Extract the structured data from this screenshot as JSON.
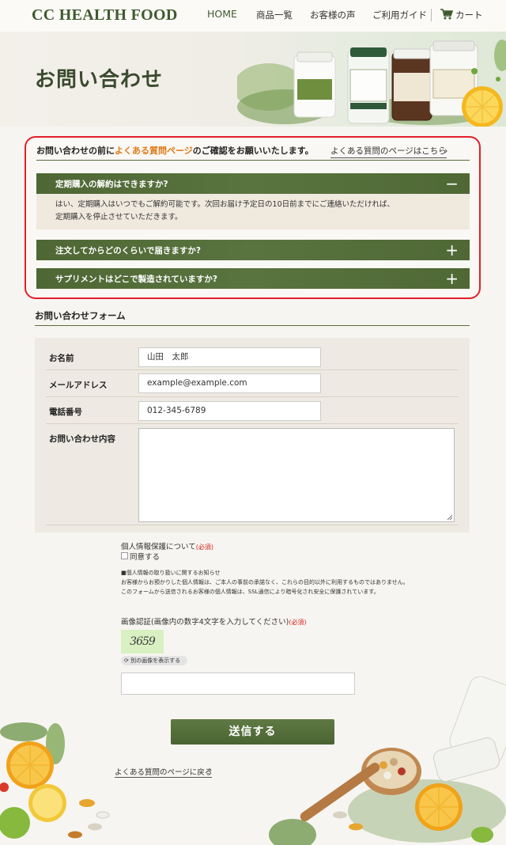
{
  "header": {
    "logo": "CC HEALTH FOOD",
    "nav": [
      "HOME",
      "商品一覧",
      "お客様の声",
      "ご利用ガイド"
    ],
    "cart_label": "カート",
    "accent_color": "#3f5a2f"
  },
  "hero": {
    "title": "お問い合わせ"
  },
  "faq": {
    "intro_before": "お問い合わせの前に",
    "intro_highlight": "よくある質問ページ",
    "intro_after": "のご確認をお願いいたします。",
    "link_label": "よくある質問のページはこちら",
    "items": [
      {
        "question": "定期購入の解約はできますか?",
        "expanded": true,
        "sign": "−",
        "answer_line1": "はい、定期購入はいつでもご解約可能です。次回お届け予定日の10日前までにご連絡いただければ、",
        "answer_line2": "定期購入を停止させていただきます。"
      },
      {
        "question": "注文してからどのくらいで届きますか?",
        "expanded": false,
        "sign": "+"
      },
      {
        "question": "サプリメントはどこで製造されていますか?",
        "expanded": false,
        "sign": "+"
      }
    ],
    "highlight_color": "#e07a17",
    "border_color": "#e0202a"
  },
  "form": {
    "title": "お問い合わせフォーム",
    "fields": {
      "name": {
        "label": "お名前",
        "value": "山田　太郎"
      },
      "email": {
        "label": "メールアドレス",
        "value": "example@example.com"
      },
      "phone": {
        "label": "電話番号",
        "value": "012-345-6789"
      },
      "message": {
        "label": "お問い合わせ内容",
        "value": ""
      }
    },
    "privacy": {
      "title": "個人情報保護について",
      "required": "(必須)",
      "agree_label": "同意する",
      "notice_heading": "■個人情報の取り扱いに関するお知らせ",
      "notice_line1": "お客様からお預かりした個人情報は、ご本人の事前の承諾なく、これらの目的以外に利用するものではありません。",
      "notice_line2": "このフォームから送信されるお客様の個人情報は、SSL通信により暗号化され安全に保護されています。"
    },
    "captcha": {
      "title": "画像認証(画像内の数字4文字を入力してください)",
      "required": "(必須)",
      "image_text": "3659",
      "refresh_label": "別の画像を表示する",
      "input_value": ""
    },
    "submit_label": "送信する",
    "back_link": "よくある質問のページに戻る"
  }
}
